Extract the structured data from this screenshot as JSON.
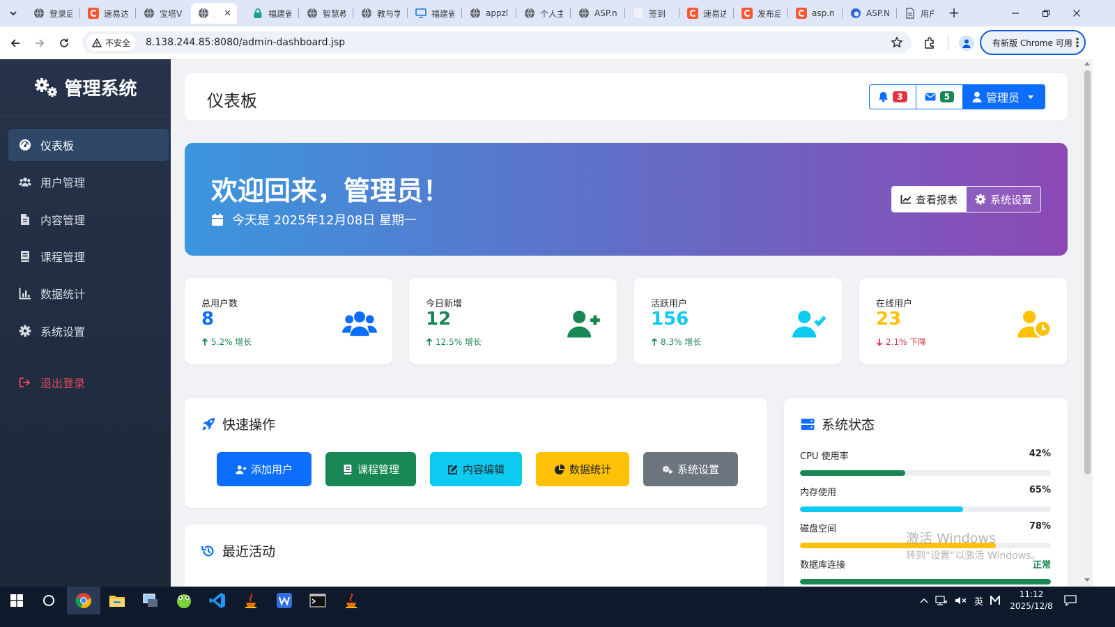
{
  "browser": {
    "tabs": [
      {
        "title": "登录后",
        "icon": "globe-icon"
      },
      {
        "title": "速易达",
        "icon": "csdn-icon"
      },
      {
        "title": "宝塔V",
        "icon": "globe-icon"
      },
      {
        "title": "后",
        "icon": "globe-icon",
        "active": true
      },
      {
        "title": "福建省",
        "icon": "lock-icon"
      },
      {
        "title": "智慧教",
        "icon": "globe-icon"
      },
      {
        "title": "教与学",
        "icon": "globe-icon"
      },
      {
        "title": "福建省",
        "icon": "monitor-icon"
      },
      {
        "title": "appzl",
        "icon": "globe-icon"
      },
      {
        "title": "个人主",
        "icon": "globe-icon"
      },
      {
        "title": "ASP.n",
        "icon": "globe-icon"
      },
      {
        "title": "签到",
        "icon": "page-icon"
      },
      {
        "title": "速易达",
        "icon": "csdn-icon"
      },
      {
        "title": "发布后",
        "icon": "csdn-icon"
      },
      {
        "title": "asp.n",
        "icon": "csdn-icon"
      },
      {
        "title": "ASP.N",
        "icon": "edge-icon"
      },
      {
        "title": "用户管",
        "icon": "doc-icon"
      }
    ],
    "security_label": "不安全",
    "url": "8.138.244.85:8080/admin-dashboard.jsp",
    "update_label": "有新版 Chrome 可用"
  },
  "sidebar": {
    "brand": "管理系统",
    "items": [
      {
        "label": "仪表板",
        "icon": "gauge-icon",
        "active": true
      },
      {
        "label": "用户管理",
        "icon": "users-icon"
      },
      {
        "label": "内容管理",
        "icon": "file-icon"
      },
      {
        "label": "课程管理",
        "icon": "book-icon"
      },
      {
        "label": "数据统计",
        "icon": "bar-chart-icon"
      },
      {
        "label": "系统设置",
        "icon": "gear-icon"
      }
    ],
    "logout": "退出登录"
  },
  "topbar": {
    "title": "仪表板",
    "notifications": "3",
    "messages": "5",
    "user": "管理员"
  },
  "welcome": {
    "title": "欢迎回来，管理员！",
    "date": "今天是 2025年12月08日 星期一",
    "report_btn": "查看报表",
    "settings_btn": "系统设置"
  },
  "stats": [
    {
      "label": "总用户数",
      "value": "8",
      "trend": "5.2% 增长",
      "direction": "up",
      "color": "#0d6efd",
      "icon": "users-icon"
    },
    {
      "label": "今日新增",
      "value": "12",
      "trend": "12.5% 增长",
      "direction": "up",
      "color": "#198754",
      "icon": "user-plus-icon"
    },
    {
      "label": "活跃用户",
      "value": "156",
      "trend": "8.3% 增长",
      "direction": "up",
      "color": "#0dcaf0",
      "icon": "user-check-icon"
    },
    {
      "label": "在线用户",
      "value": "23",
      "trend": "2.1% 下降",
      "direction": "down",
      "color": "#ffc107",
      "icon": "user-clock-icon"
    }
  ],
  "quick_actions": {
    "title": "快速操作",
    "buttons": [
      {
        "label": "添加用户",
        "color": "#0d6efd",
        "icon": "user-plus-icon"
      },
      {
        "label": "课程管理",
        "color": "#198754",
        "icon": "book-icon"
      },
      {
        "label": "内容编辑",
        "color": "#0dcaf0",
        "icon": "edit-icon"
      },
      {
        "label": "数据统计",
        "color": "#ffc107",
        "icon": "pie-chart-icon"
      },
      {
        "label": "系统设置",
        "color": "#6c757d",
        "icon": "gears-icon"
      }
    ]
  },
  "recent_activity": {
    "title": "最近活动"
  },
  "system_status": {
    "title": "系统状态",
    "metrics": [
      {
        "label": "CPU 使用率",
        "value": "42%",
        "level": 0.42,
        "color": "#198754"
      },
      {
        "label": "内存使用",
        "value": "65%",
        "level": 0.65,
        "color": "#0dcaf0"
      },
      {
        "label": "磁盘空间",
        "value": "78%",
        "level": 0.78,
        "color": "#ffc107"
      },
      {
        "label": "数据库连接",
        "value": "正常",
        "level": 1.0,
        "color": "#198754"
      }
    ]
  },
  "watermark": {
    "line1": "激活 Windows",
    "line2": "转到“设置”以激活 Windows。"
  },
  "taskbar": {
    "apps": [
      "windows-start-icon",
      "search-circle-icon",
      "chrome-icon",
      "file-explorer-icon",
      "remote-desktop-icon",
      "frog-app-icon",
      "vscode-icon",
      "java-icon",
      "wps-icon",
      "terminal-icon",
      "java-icon"
    ],
    "ime": "英",
    "time": "11:12",
    "date": "2025/12/8"
  }
}
